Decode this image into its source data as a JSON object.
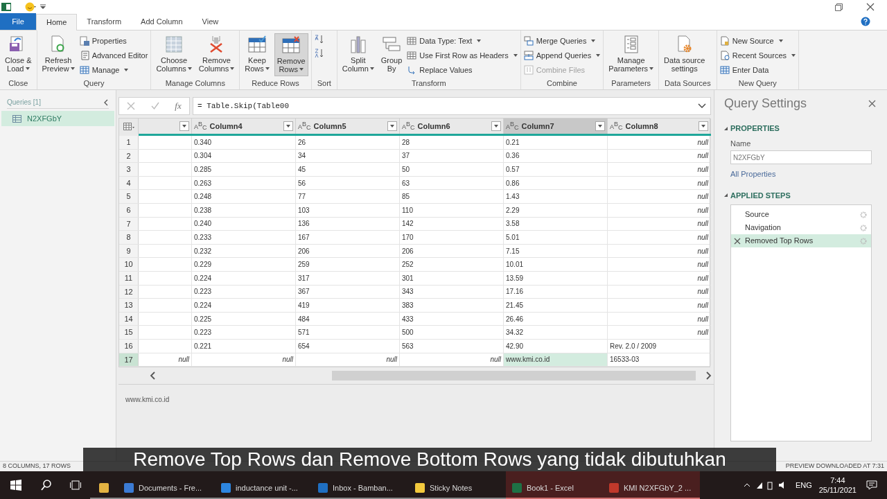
{
  "tabs": [
    {
      "label": "File",
      "kind": "file",
      "selected": false
    },
    {
      "label": "Home",
      "kind": "tab",
      "selected": true
    },
    {
      "label": "Transform",
      "kind": "tab",
      "selected": false
    },
    {
      "label": "Add Column",
      "kind": "tab",
      "selected": false
    },
    {
      "label": "View",
      "kind": "tab",
      "selected": false
    }
  ],
  "ribbon": [
    {
      "label": "Close",
      "items": [
        {
          "kind": "large",
          "lines": [
            "Close &",
            "Load"
          ],
          "dropdown": true,
          "pressed": false
        }
      ]
    },
    {
      "label": "Query",
      "items": [
        {
          "kind": "large",
          "lines": [
            "Refresh",
            "Preview"
          ],
          "dropdown": true,
          "pressed": false
        },
        {
          "kind": "small",
          "label": "Properties",
          "dropdown": false,
          "disabled": false
        },
        {
          "kind": "small",
          "label": "Advanced Editor",
          "dropdown": false,
          "disabled": false
        },
        {
          "kind": "small",
          "label": "Manage",
          "dropdown": true,
          "disabled": false
        }
      ]
    },
    {
      "label": "Manage Columns",
      "items": [
        {
          "kind": "large",
          "lines": [
            "Choose",
            "Columns"
          ],
          "dropdown": true,
          "pressed": false
        },
        {
          "kind": "large",
          "lines": [
            "Remove",
            "Columns"
          ],
          "dropdown": true,
          "pressed": false
        }
      ]
    },
    {
      "label": "Reduce Rows",
      "items": [
        {
          "kind": "large",
          "lines": [
            "Keep",
            "Rows"
          ],
          "dropdown": true,
          "pressed": false
        },
        {
          "kind": "large",
          "lines": [
            "Remove",
            "Rows"
          ],
          "dropdown": true,
          "pressed": true
        }
      ]
    },
    {
      "label": "Sort",
      "items": [
        {
          "kind": "icon"
        },
        {
          "kind": "icon"
        }
      ]
    },
    {
      "label": "Transform",
      "items": [
        {
          "kind": "large",
          "lines": [
            "Split",
            "Column"
          ],
          "dropdown": true,
          "pressed": false
        },
        {
          "kind": "large",
          "lines": [
            "Group",
            "By"
          ],
          "dropdown": false,
          "pressed": false
        },
        {
          "kind": "small",
          "label": "Data Type: Text",
          "dropdown": true,
          "disabled": false
        },
        {
          "kind": "small",
          "label": "Use First Row as Headers",
          "dropdown": true,
          "disabled": false
        },
        {
          "kind": "small",
          "label": "Replace Values",
          "dropdown": false,
          "disabled": false
        }
      ]
    },
    {
      "label": "Combine",
      "items": [
        {
          "kind": "small",
          "label": "Merge Queries",
          "dropdown": true,
          "disabled": false
        },
        {
          "kind": "small",
          "label": "Append Queries",
          "dropdown": true,
          "disabled": false
        },
        {
          "kind": "small",
          "label": "Combine Files",
          "dropdown": false,
          "disabled": true
        }
      ]
    },
    {
      "label": "Parameters",
      "items": [
        {
          "kind": "large",
          "lines": [
            "Manage",
            "Parameters"
          ],
          "dropdown": true,
          "pressed": false
        }
      ]
    },
    {
      "label": "Data Sources",
      "items": [
        {
          "kind": "large",
          "lines": [
            "Data source",
            "settings"
          ],
          "dropdown": false,
          "pressed": false
        }
      ]
    },
    {
      "label": "New Query",
      "items": [
        {
          "kind": "small",
          "label": "New Source",
          "dropdown": true,
          "disabled": false
        },
        {
          "kind": "small",
          "label": "Recent Sources",
          "dropdown": true,
          "disabled": false
        },
        {
          "kind": "small",
          "label": "Enter Data",
          "dropdown": false,
          "disabled": false
        }
      ]
    }
  ],
  "queries_pane": {
    "title": "Queries [1]",
    "items": [
      {
        "label": "N2XFGbY",
        "selected": true
      }
    ]
  },
  "formula_bar": {
    "fx": "fx",
    "formula": "= Table.Skip(Table00"
  },
  "table": {
    "columns": [
      {
        "selected": false
      },
      {
        "type": "ABC",
        "label": "Column4",
        "selected": false
      },
      {
        "type": "ABC",
        "label": "Column5",
        "selected": false
      },
      {
        "type": "ABC",
        "label": "Column6",
        "selected": false
      },
      {
        "type": "ABC",
        "label": "Column7",
        "selected": true
      },
      {
        "type": "ABC",
        "label": "Column8",
        "selected": false
      }
    ],
    "rows": [
      {
        "n": "1",
        "selected": false,
        "cells": [
          null,
          "0.340",
          "26",
          "28",
          "0.21",
          {
            "text": "null",
            "kind": "null"
          }
        ]
      },
      {
        "n": "2",
        "selected": false,
        "cells": [
          null,
          "0.304",
          "34",
          "37",
          "0.36",
          {
            "text": "null",
            "kind": "null"
          }
        ]
      },
      {
        "n": "3",
        "selected": false,
        "cells": [
          null,
          "0.285",
          "45",
          "50",
          "0.57",
          {
            "text": "null",
            "kind": "null"
          }
        ]
      },
      {
        "n": "4",
        "selected": false,
        "cells": [
          null,
          "0.263",
          "56",
          "63",
          "0.86",
          {
            "text": "null",
            "kind": "null"
          }
        ]
      },
      {
        "n": "5",
        "selected": false,
        "cells": [
          null,
          "0.248",
          "77",
          "85",
          "1.43",
          {
            "text": "null",
            "kind": "null"
          }
        ]
      },
      {
        "n": "6",
        "selected": false,
        "cells": [
          null,
          "0.238",
          "103",
          "110",
          "2.29",
          {
            "text": "null",
            "kind": "null"
          }
        ]
      },
      {
        "n": "7",
        "selected": false,
        "cells": [
          null,
          "0.240",
          "136",
          "142",
          "3.58",
          {
            "text": "null",
            "kind": "null"
          }
        ]
      },
      {
        "n": "8",
        "selected": false,
        "cells": [
          null,
          "0.233",
          "167",
          "170",
          "5.01",
          {
            "text": "null",
            "kind": "null"
          }
        ]
      },
      {
        "n": "9",
        "selected": false,
        "cells": [
          null,
          "0.232",
          "206",
          "206",
          "7.15",
          {
            "text": "null",
            "kind": "null"
          }
        ]
      },
      {
        "n": "10",
        "selected": false,
        "cells": [
          null,
          "0.229",
          "259",
          "252",
          "10.01",
          {
            "text": "null",
            "kind": "null"
          }
        ]
      },
      {
        "n": "11",
        "selected": false,
        "cells": [
          null,
          "0.224",
          "317",
          "301",
          "13.59",
          {
            "text": "null",
            "kind": "null"
          }
        ]
      },
      {
        "n": "12",
        "selected": false,
        "cells": [
          null,
          "0.223",
          "367",
          "343",
          "17.16",
          {
            "text": "null",
            "kind": "null"
          }
        ]
      },
      {
        "n": "13",
        "selected": false,
        "cells": [
          null,
          "0.224",
          "419",
          "383",
          "21.45",
          {
            "text": "null",
            "kind": "null"
          }
        ]
      },
      {
        "n": "14",
        "selected": false,
        "cells": [
          null,
          "0.225",
          "484",
          "433",
          "26.46",
          {
            "text": "null",
            "kind": "null"
          }
        ]
      },
      {
        "n": "15",
        "selected": false,
        "cells": [
          null,
          "0.223",
          "571",
          "500",
          "34.32",
          {
            "text": "null",
            "kind": "null"
          }
        ]
      },
      {
        "n": "16",
        "selected": false,
        "cells": [
          null,
          "0.221",
          "654",
          "563",
          "42.90",
          "Rev. 2.0 / 2009"
        ]
      },
      {
        "n": "17",
        "selected": true,
        "cells": [
          {
            "text": "null",
            "kind": "null"
          },
          {
            "text": "null",
            "kind": "null"
          },
          {
            "text": "null",
            "kind": "null"
          },
          {
            "text": "null",
            "kind": "null"
          },
          "www.kmi.co.id",
          "16533-03"
        ]
      }
    ]
  },
  "cell_preview": "www.kmi.co.id",
  "query_settings": {
    "title": "Query Settings",
    "properties_heading": "PROPERTIES",
    "name_label": "Name",
    "name_value": "N2XFGbY",
    "all_properties": "All Properties",
    "steps_heading": "APPLIED STEPS",
    "steps": [
      {
        "label": "Source",
        "selected": false
      },
      {
        "label": "Navigation",
        "selected": false
      },
      {
        "label": "Removed Top Rows",
        "selected": true
      }
    ]
  },
  "status_bar": {
    "left": "8 COLUMNS, 17 ROWS",
    "right": "PREVIEW DOWNLOADED AT 7:31"
  },
  "caption": "Remove Top Rows dan Remove Bottom Rows yang tidak dibutuhkan",
  "taskbar": {
    "apps": [
      {
        "active": false
      },
      {
        "label": "Documents - Fre...",
        "active": false
      },
      {
        "label": "inductance unit -...",
        "active": false
      },
      {
        "label": "Inbox - Bamban...",
        "active": false
      },
      {
        "label": "Sticky Notes",
        "active": false
      },
      {
        "label": "Book1 - Excel",
        "active": true
      },
      {
        "label": "KMI N2XFGbY_2 ...",
        "active": true
      }
    ],
    "language": "ENG",
    "time": "7:44",
    "date": "25/11/2021"
  }
}
